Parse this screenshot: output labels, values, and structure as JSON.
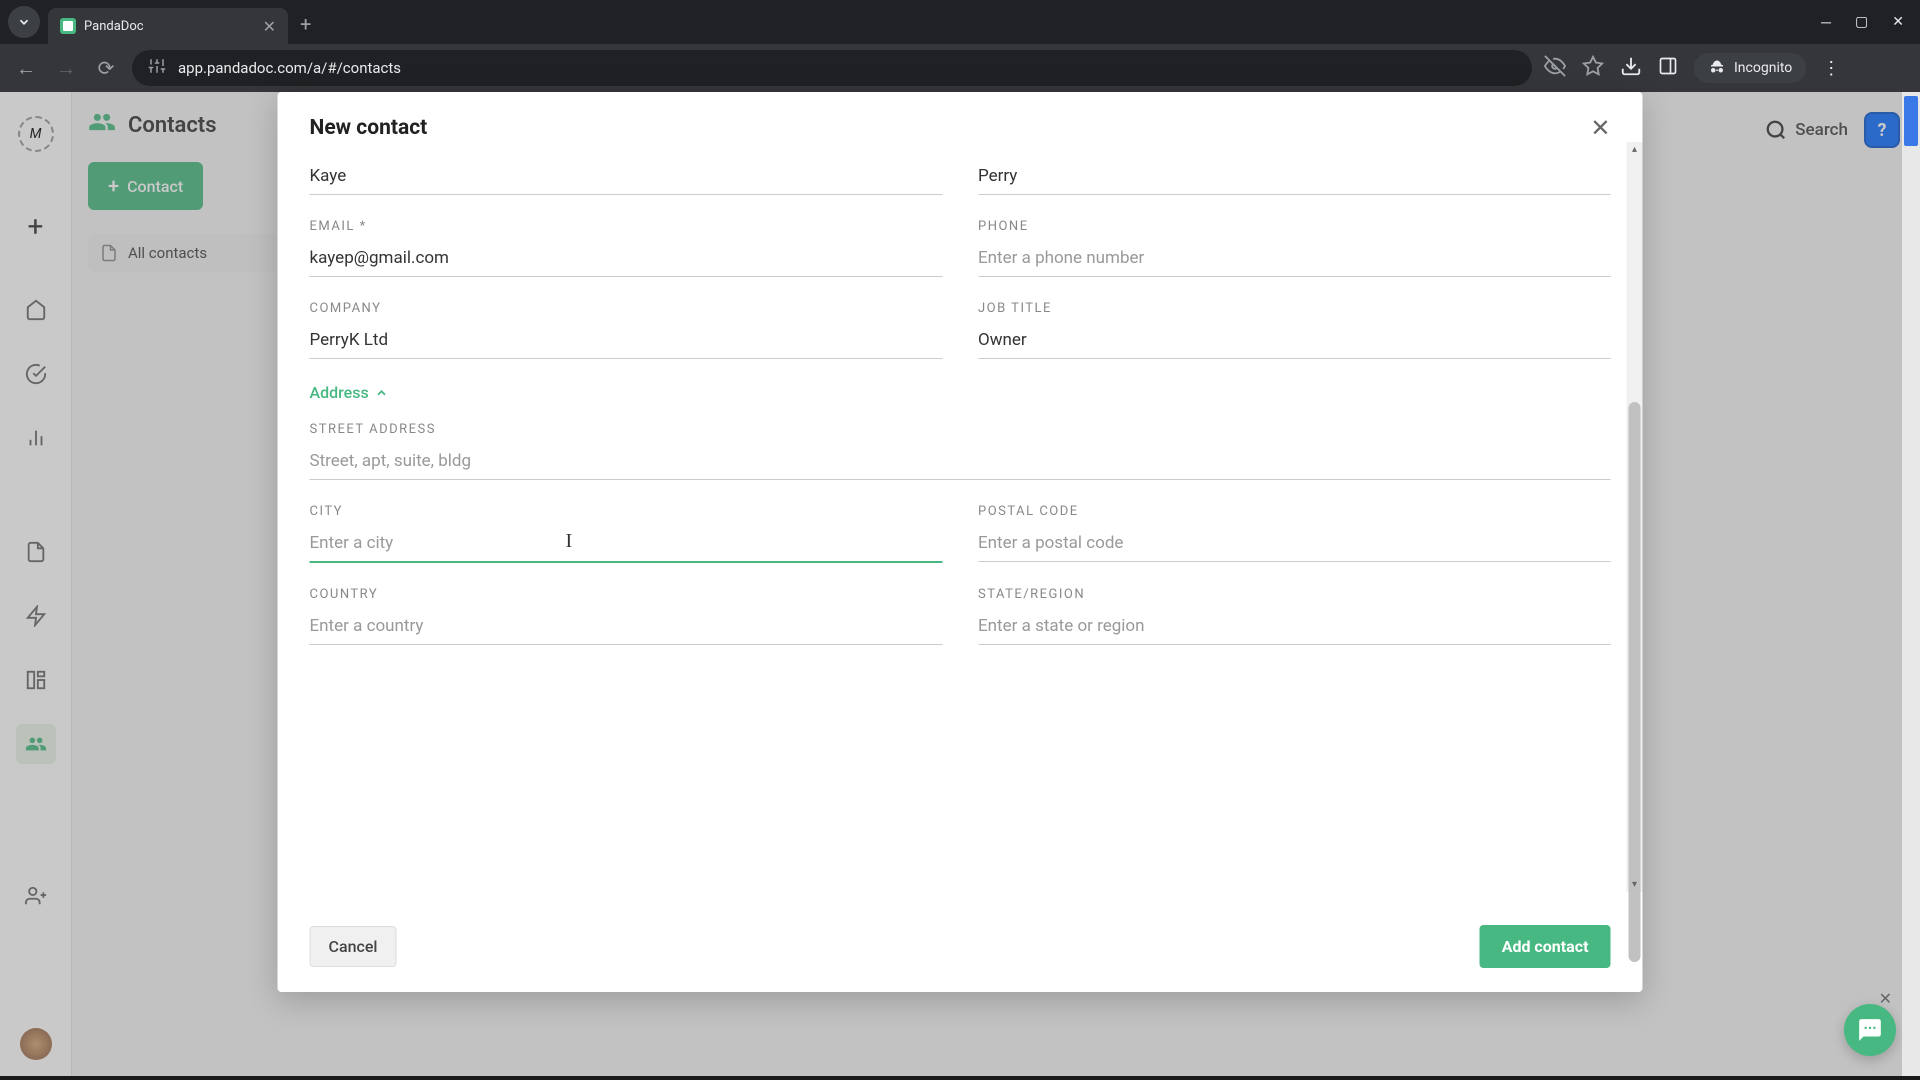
{
  "browser": {
    "tab_title": "PandaDoc",
    "url": "app.pandadoc.com/a/#/contacts",
    "incognito_label": "Incognito"
  },
  "app": {
    "page_title": "Contacts",
    "new_contact_btn": "Contact",
    "all_contacts_label": "All contacts",
    "search_label": "Search"
  },
  "modal": {
    "title": "New contact",
    "fields": {
      "first_name": {
        "value": "Kaye"
      },
      "last_name": {
        "value": "Perry"
      },
      "email": {
        "label": "EMAIL *",
        "value": "kayep@gmail.com"
      },
      "phone": {
        "label": "PHONE",
        "placeholder": "Enter a phone number",
        "value": ""
      },
      "company": {
        "label": "COMPANY",
        "value": "PerryK Ltd"
      },
      "job_title": {
        "label": "JOB TITLE",
        "value": "Owner"
      },
      "address_toggle": "Address",
      "street": {
        "label": "STREET ADDRESS",
        "placeholder": "Street, apt, suite, bldg",
        "value": ""
      },
      "city": {
        "label": "CITY",
        "placeholder": "Enter a city",
        "value": ""
      },
      "postal": {
        "label": "POSTAL CODE",
        "placeholder": "Enter a postal code",
        "value": ""
      },
      "country": {
        "label": "COUNTRY",
        "placeholder": "Enter a country",
        "value": ""
      },
      "state": {
        "label": "STATE/REGION",
        "placeholder": "Enter a state or region",
        "value": ""
      }
    },
    "cancel_label": "Cancel",
    "submit_label": "Add contact"
  }
}
